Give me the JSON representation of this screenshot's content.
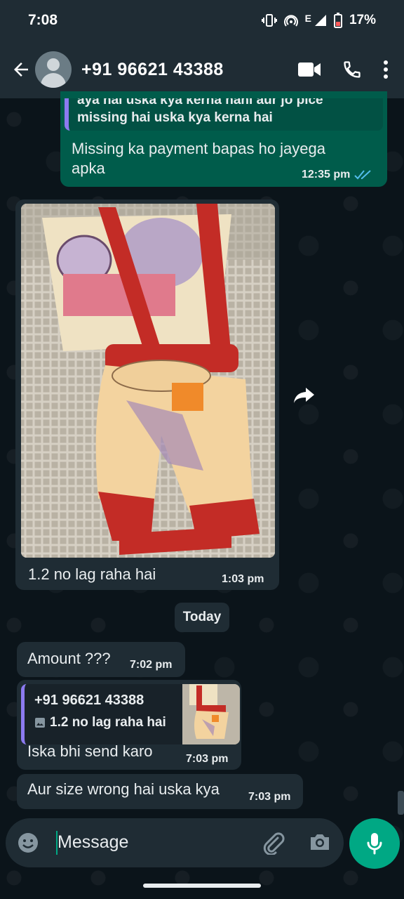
{
  "status_bar": {
    "time": "7:08",
    "network": "E",
    "battery": "17%"
  },
  "header": {
    "contact": "+91 96621 43388"
  },
  "messages": {
    "quoted_partial_line1": "aya hai uska kya kerna hani aur jo pice",
    "quoted_partial_line2": "missing hai uska kya kerna hai",
    "out_1_text": "Missing ka payment bapas ho jayega apka",
    "out_1_time": "12:35 pm",
    "photo_caption": "1.2 no lag raha hai",
    "photo_time": "1:03 pm",
    "date_chip": "Today",
    "in_amount_text": "Amount ???",
    "in_amount_time": "7:02 pm",
    "reply_quote_name": "+91 96621 43388",
    "reply_quote_text": "1.2 no lag raha hai",
    "reply_text": "Iska bhi send karo",
    "reply_time": "7:03 pm",
    "last_text": "Aur size wrong hai uska kya",
    "last_time": "7:03 pm"
  },
  "composer": {
    "placeholder": "Message"
  },
  "colors": {
    "outgoing": "#005c4b",
    "incoming": "#1f2c34",
    "accent": "#00a884",
    "read_ticks": "#53bdeb"
  },
  "icons": [
    "back-arrow-icon",
    "video-call-icon",
    "voice-call-icon",
    "more-vert-icon",
    "double-check-icon",
    "forward-icon",
    "image-icon",
    "emoji-icon",
    "attach-icon",
    "camera-icon",
    "mic-icon"
  ]
}
